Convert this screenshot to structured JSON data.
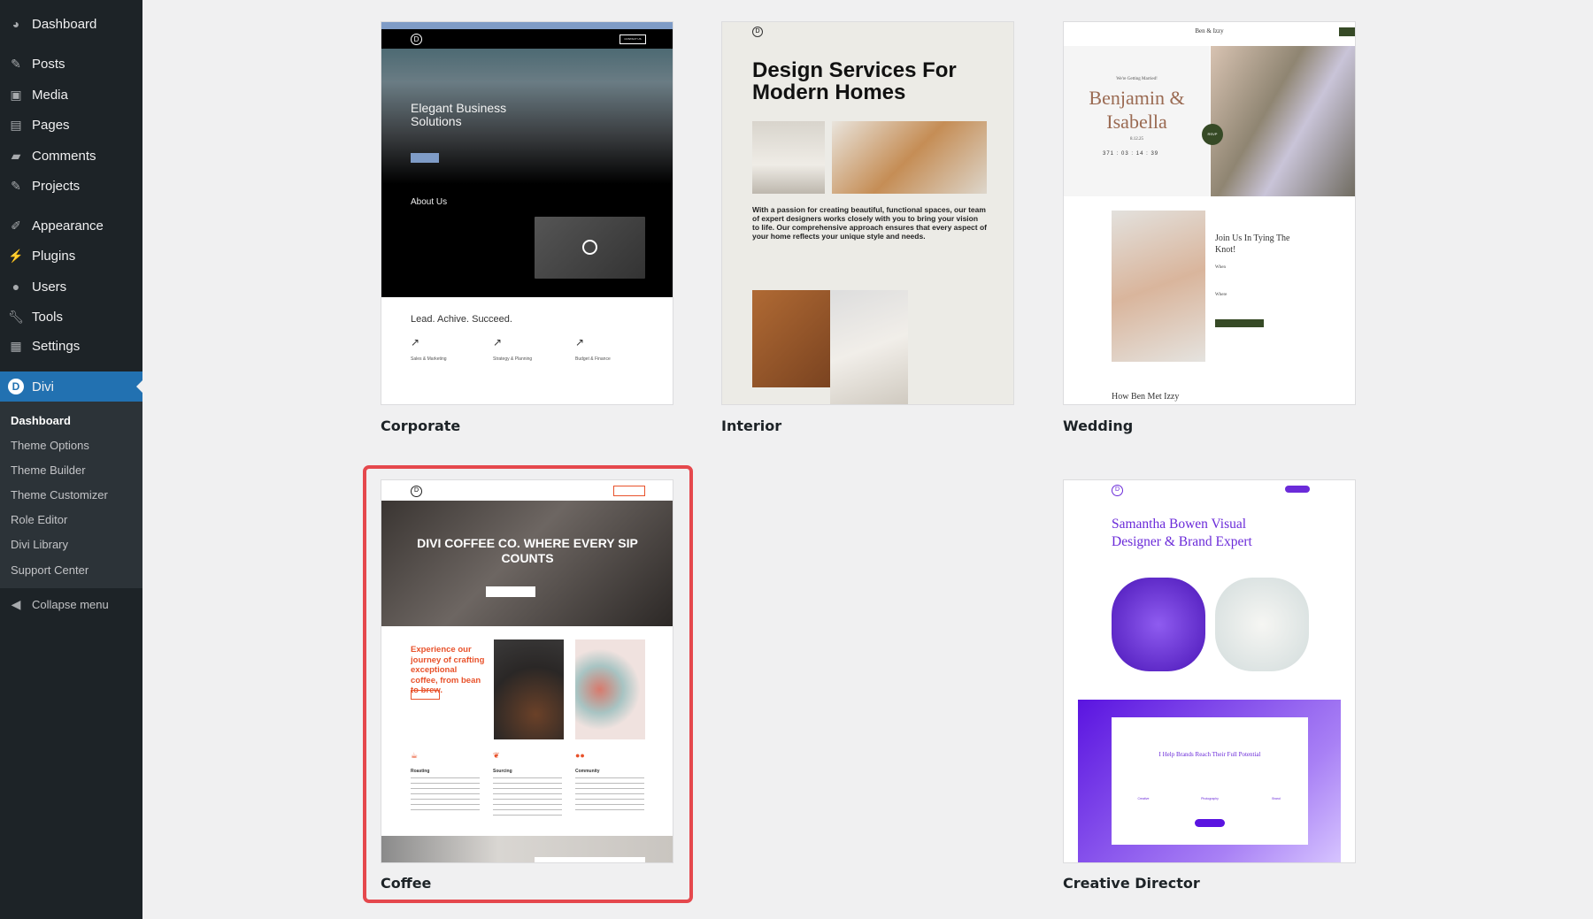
{
  "sidebar": {
    "items": [
      {
        "label": "Dashboard",
        "icon": "dashboard-icon"
      },
      {
        "label": "Posts",
        "icon": "pin-icon"
      },
      {
        "label": "Media",
        "icon": "media-icon"
      },
      {
        "label": "Pages",
        "icon": "pages-icon"
      },
      {
        "label": "Comments",
        "icon": "comment-icon"
      },
      {
        "label": "Projects",
        "icon": "pin-icon"
      },
      {
        "label": "Appearance",
        "icon": "paintbrush-icon"
      },
      {
        "label": "Plugins",
        "icon": "plugin-icon"
      },
      {
        "label": "Users",
        "icon": "user-icon"
      },
      {
        "label": "Tools",
        "icon": "wrench-icon"
      },
      {
        "label": "Settings",
        "icon": "settings-icon"
      }
    ],
    "divi": {
      "label": "Divi",
      "icon": "divi-logo-icon",
      "accent": "#2271b1"
    },
    "submenu": [
      "Dashboard",
      "Theme Options",
      "Theme Builder",
      "Theme Customizer",
      "Role Editor",
      "Divi Library",
      "Support Center"
    ],
    "collapse": "Collapse menu"
  },
  "layouts": [
    {
      "label": "Corporate",
      "preview": {
        "hero": "Elegant Business Solutions",
        "about": "About Us",
        "tagline": "Lead. Achive. Succeed.",
        "columns": [
          "Sales & Marketing",
          "Strategy & Planning",
          "Budget & Finance"
        ],
        "cta": "CONTACT US"
      }
    },
    {
      "label": "Interior",
      "preview": {
        "title": "Design Services For Modern Homes",
        "body": "With a passion for creating beautiful, functional spaces, our team of expert designers works closely with you to bring your vision to life. Our comprehensive approach ensures that every aspect of your home reflects your unique style and needs."
      }
    },
    {
      "label": "Wedding",
      "preview": {
        "brand": "Ben & Izzy",
        "kicker": "We're Getting Married!",
        "names": "Benjamin & Isabella",
        "date": "8.12.25",
        "countdown": [
          "371",
          "03",
          "14",
          "39"
        ],
        "rsvp": "RSVP",
        "join": "Join Us In Tying The Knot!",
        "when": "When",
        "where": "Where",
        "story": "How Ben Met Izzy"
      }
    },
    {
      "label": "Coffee",
      "selected": true,
      "preview": {
        "hero": "DIVI COFFEE CO. WHERE EVERY SIP COUNTS",
        "intro": "Experience our journey of crafting exceptional coffee, from bean to brew.",
        "features": [
          "Roasting",
          "Sourcing",
          "Community"
        ],
        "accent": "#e8522b"
      }
    },
    {
      "label": "Creative Director",
      "preview": {
        "title": "Samantha Bowen Visual Designer & Brand Expert",
        "banner": "I Help Brands Reach Their Full Potential",
        "services": [
          "Creative",
          "Photography",
          "Brand"
        ],
        "accent": "#6b2bd9"
      }
    }
  ],
  "highlight_color": "#e5484d"
}
